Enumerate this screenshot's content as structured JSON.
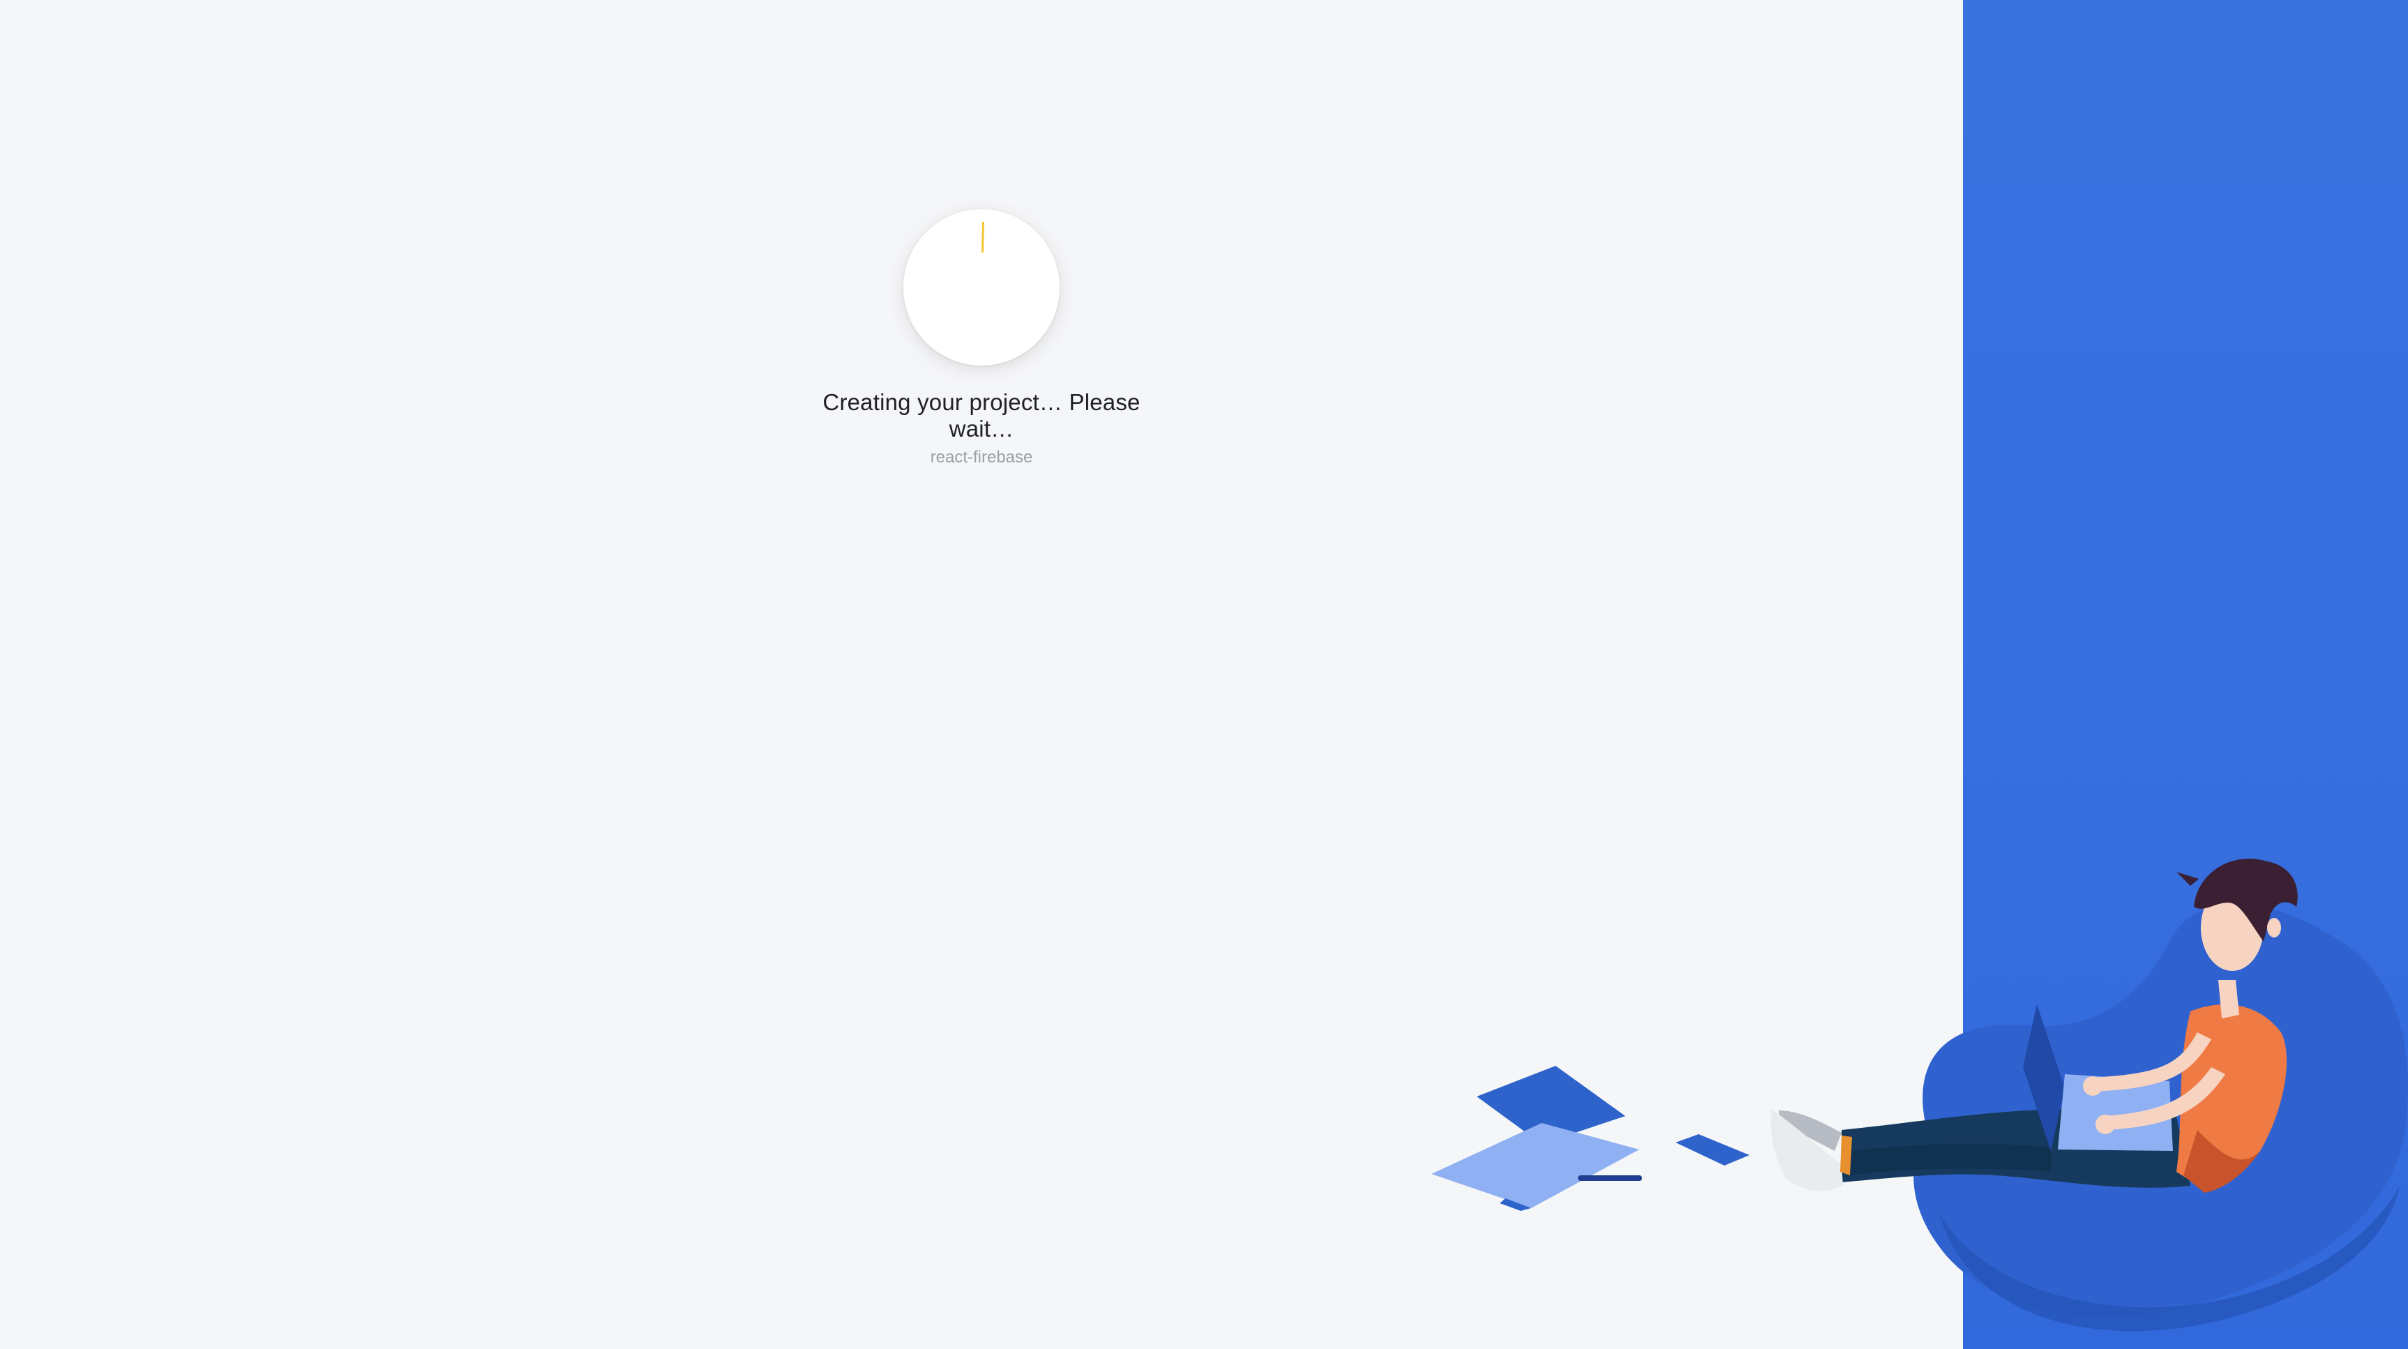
{
  "loading": {
    "status_text": "Creating your project… Please wait…",
    "project_name": "react-firebase",
    "spinner_accent_color": "#f4c430"
  },
  "side_panel": {
    "background_color": "#3a72e0"
  },
  "illustration": {
    "description_icon": "person-on-beanbag-with-laptop-illustration"
  }
}
